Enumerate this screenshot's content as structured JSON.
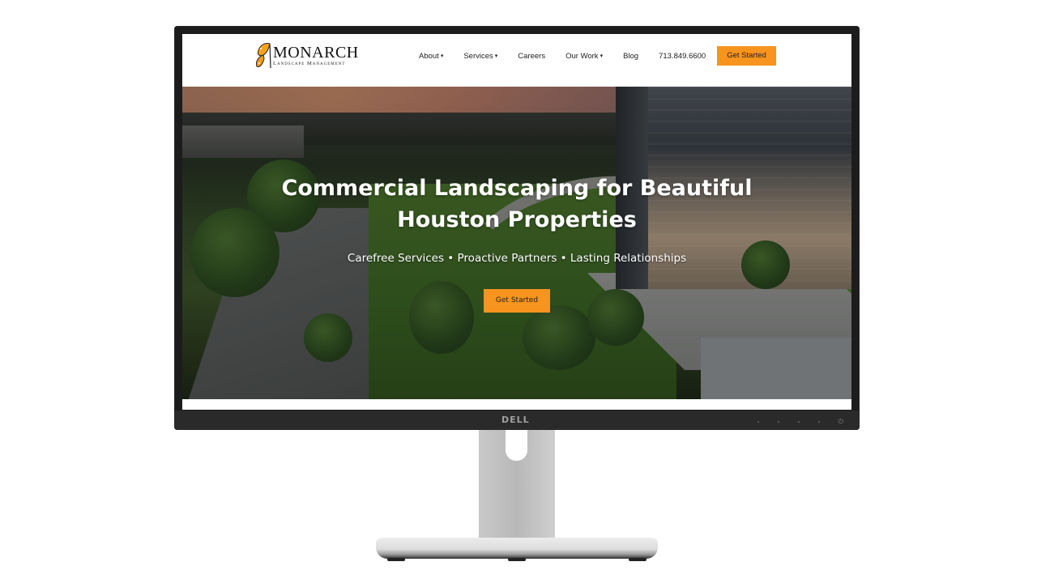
{
  "device": {
    "brand_logo": "DELL",
    "power_icon": "power-icon"
  },
  "site": {
    "logo": {
      "name": "MONARCH",
      "tagline": "Landscape Management",
      "icon": "butterfly-icon"
    },
    "nav": {
      "items": [
        {
          "label": "About",
          "has_dropdown": true
        },
        {
          "label": "Services",
          "has_dropdown": true
        },
        {
          "label": "Careers",
          "has_dropdown": false
        },
        {
          "label": "Our Work",
          "has_dropdown": true
        },
        {
          "label": "Blog",
          "has_dropdown": false
        }
      ],
      "phone": "713.849.6600",
      "cta_label": "Get Started",
      "caret_glyph": "▾"
    },
    "hero": {
      "title_line1": "Commercial Landscaping for Beautiful",
      "title_line2": "Houston Properties",
      "subtitle": "Carefree Services • Proactive Partners • Lasting Relationships",
      "cta_label": "Get Started"
    }
  },
  "colors": {
    "accent": "#f7941d",
    "bezel": "#1c1c1c",
    "text": "#222222"
  }
}
